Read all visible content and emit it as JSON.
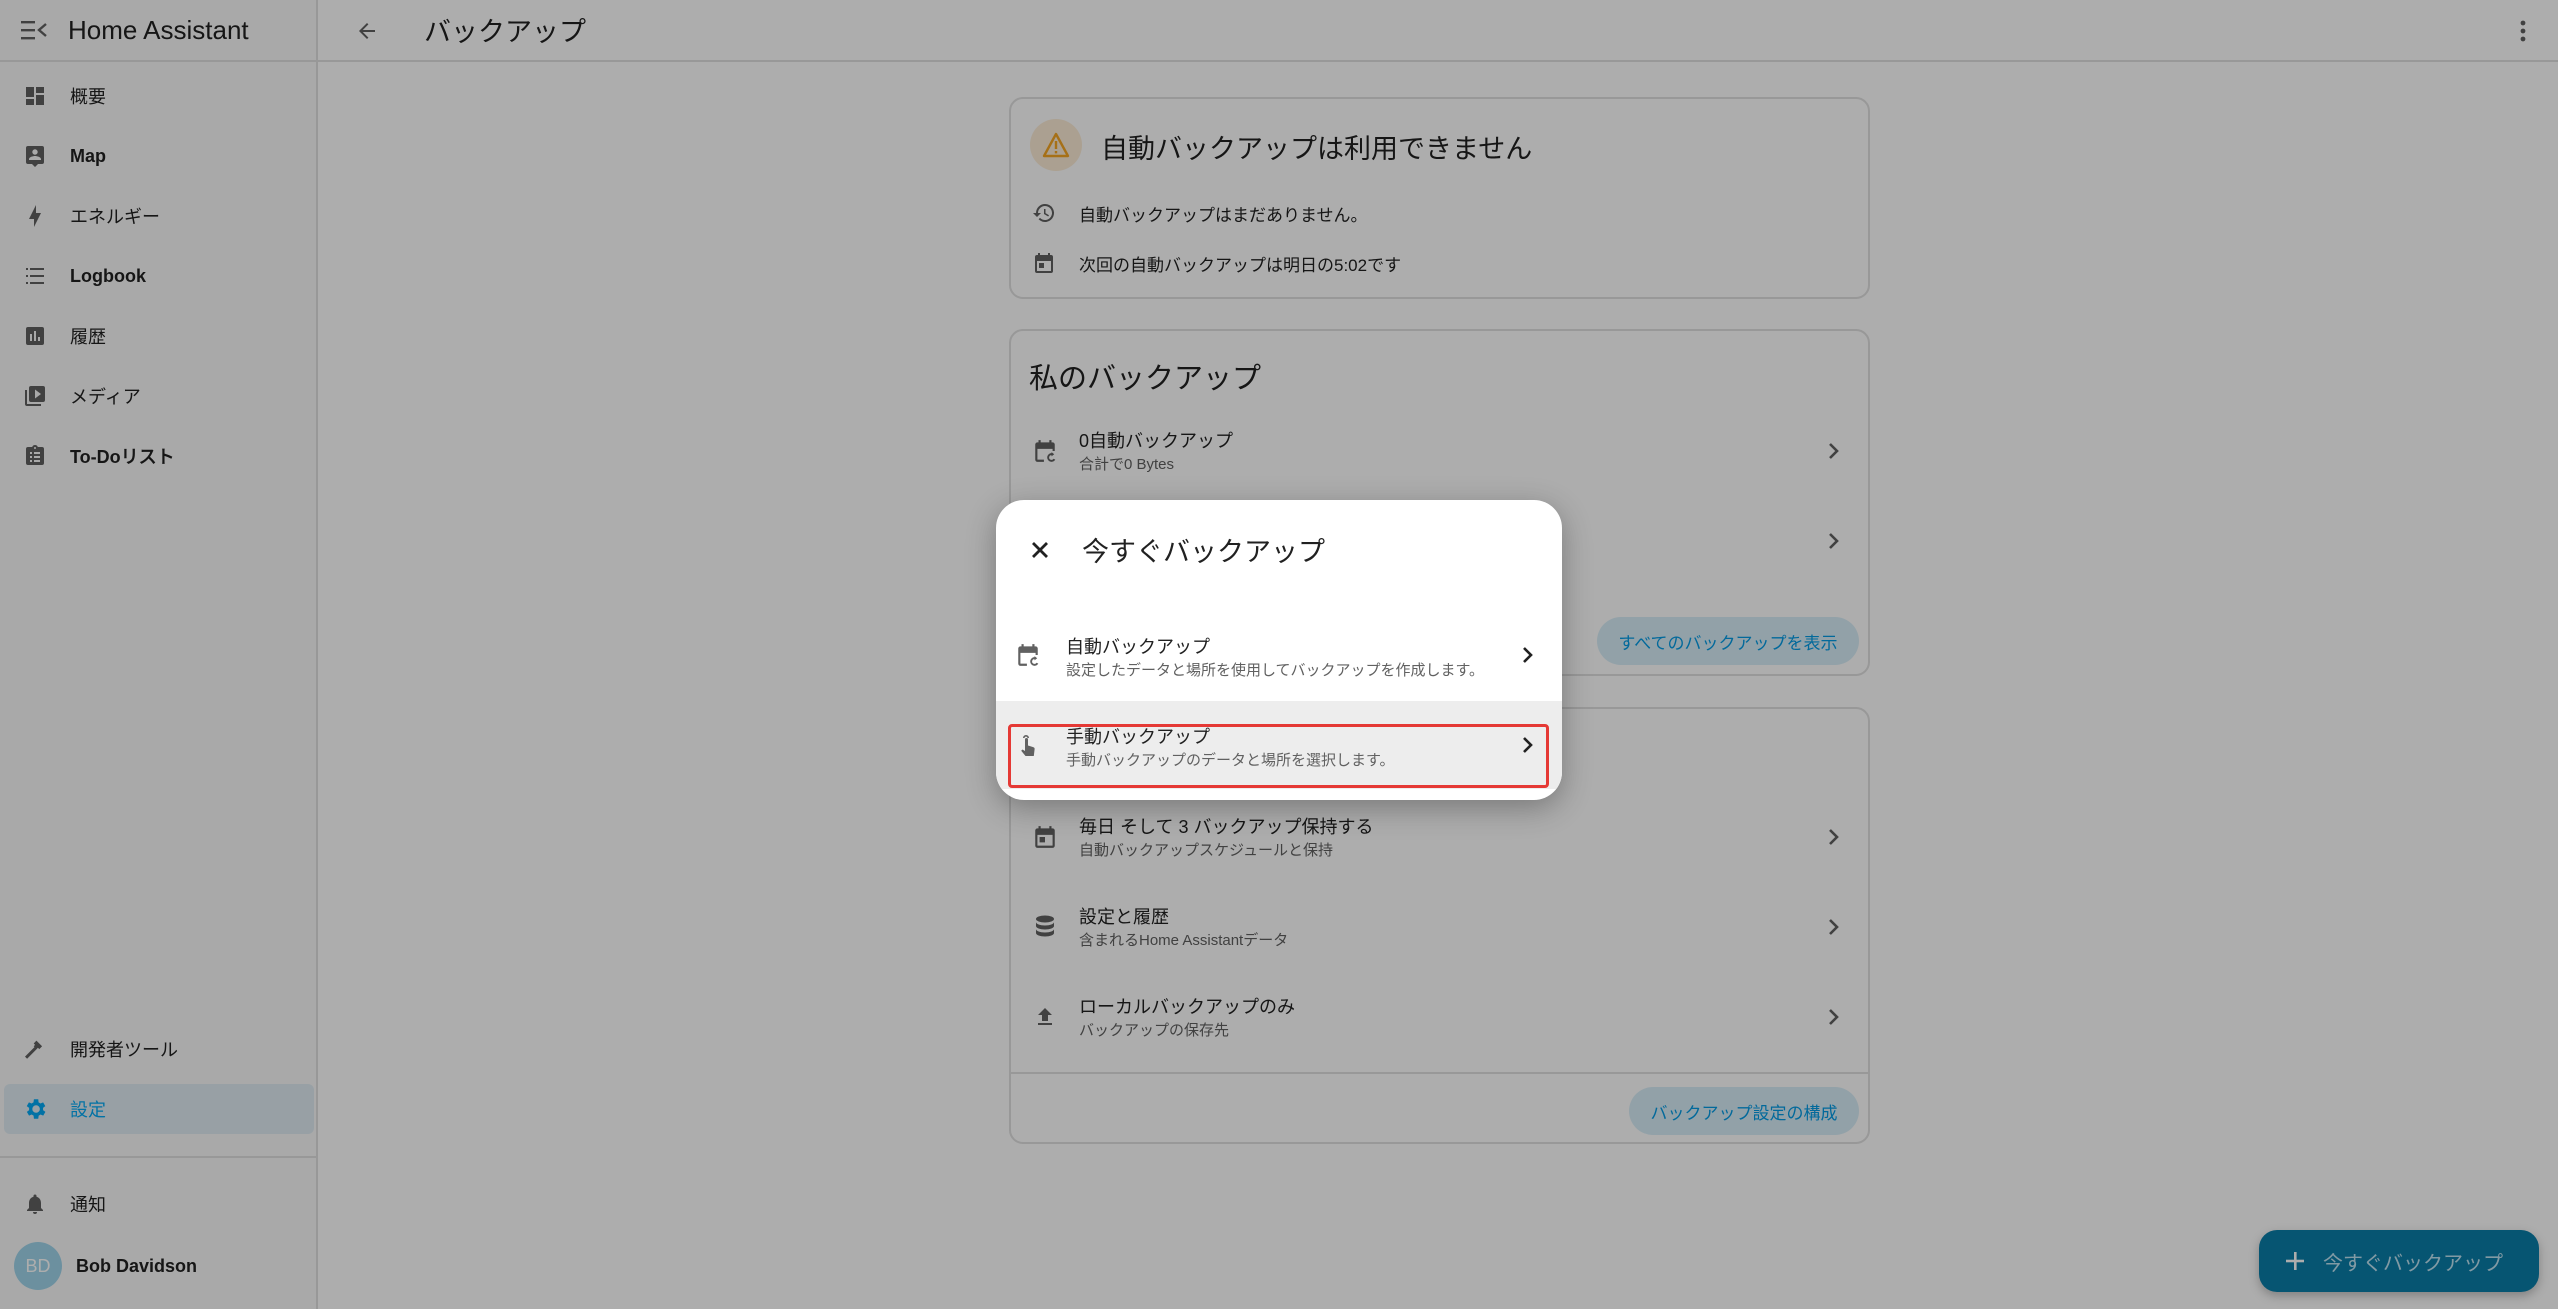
{
  "app": {
    "title": "Home Assistant"
  },
  "sidebar": {
    "items": [
      {
        "label": "概要",
        "icon": "dashboard-icon"
      },
      {
        "label": "Map",
        "icon": "map-person-icon"
      },
      {
        "label": "エネルギー",
        "icon": "lightning-icon"
      },
      {
        "label": "Logbook",
        "icon": "list-icon"
      },
      {
        "label": "履歴",
        "icon": "chart-bar-icon"
      },
      {
        "label": "メディア",
        "icon": "media-play-icon"
      },
      {
        "label": "To-Doリスト",
        "icon": "clipboard-list-icon"
      }
    ],
    "bottom_items": [
      {
        "label": "開発者ツール",
        "icon": "hammer-icon"
      },
      {
        "label": "設定",
        "icon": "gear-icon"
      }
    ],
    "notifications": {
      "label": "通知",
      "icon": "bell-icon"
    },
    "user": {
      "initials": "BD",
      "name": "Bob Davidson"
    }
  },
  "header": {
    "title": "バックアップ"
  },
  "status_card": {
    "title": "自動バックアップは利用できません",
    "rows": [
      {
        "text": "自動バックアップはまだありません。",
        "icon": "history-icon"
      },
      {
        "text": "次回の自動バックアップは明日の5:02です",
        "icon": "calendar-icon"
      }
    ]
  },
  "my_backups_card": {
    "title": "私のバックアップ",
    "rows": [
      {
        "primary": "0自動バックアップ",
        "secondary": "合計で0 Bytes",
        "icon": "calendar-sync-icon"
      }
    ],
    "show_all_label": "すべてのバックアップを表示"
  },
  "settings_card": {
    "rows": [
      {
        "primary": "毎日 そして 3 バックアップ保持する",
        "secondary": "自動バックアップスケジュールと保持",
        "icon": "calendar-icon"
      },
      {
        "primary": "設定と履歴",
        "secondary": "含まれるHome Assistantデータ",
        "icon": "database-icon"
      },
      {
        "primary": "ローカルバックアップのみ",
        "secondary": "バックアップの保存先",
        "icon": "upload-icon"
      }
    ],
    "configure_label": "バックアップ設定の構成"
  },
  "fab": {
    "label": "今すぐバックアップ",
    "icon": "plus-icon"
  },
  "dialog": {
    "title": "今すぐバックアップ",
    "options": [
      {
        "primary": "自動バックアップ",
        "secondary": "設定したデータと場所を使用してバックアップを作成します。",
        "icon": "calendar-sync-icon"
      },
      {
        "primary": "手動バックアップ",
        "secondary": "手動バックアップのデータと場所を選択します。",
        "icon": "gesture-tap-icon"
      }
    ]
  },
  "colors": {
    "accent": "#03a9f4",
    "fab": "#0a7ea8",
    "warning": "#f5a623",
    "highlight": "#e53935"
  }
}
